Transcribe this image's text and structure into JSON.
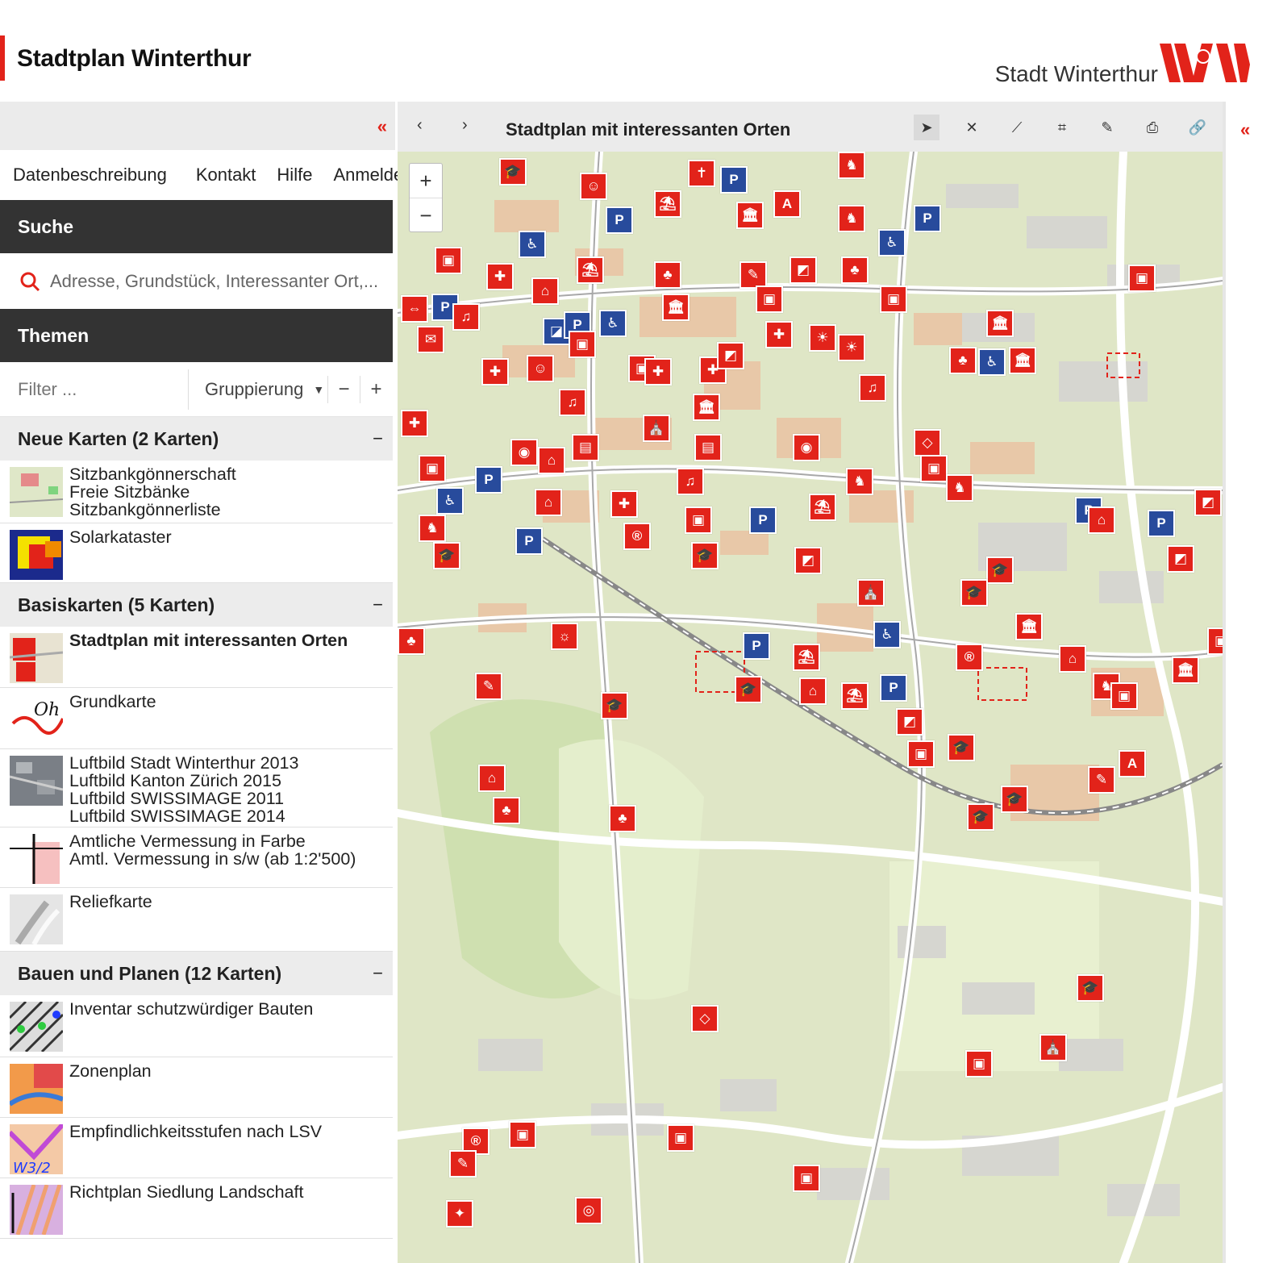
{
  "header": {
    "title": "Stadtplan Winterthur",
    "brand": "Stadt Winterthur",
    "accent_color": "#e2231a"
  },
  "left_panel": {
    "collapse_icon": "double-chevron-left-icon",
    "nav": [
      "Datenbeschreibung",
      "Kontakt",
      "Hilfe",
      "Anmelden"
    ],
    "search": {
      "heading": "Suche",
      "placeholder": "Adresse, Grundstück, Interessanter Ort,..."
    },
    "themes": {
      "heading": "Themen",
      "filter_placeholder": "Filter ...",
      "grouping_label": "Gruppierung",
      "collapse_all": "−",
      "expand_all": "+"
    },
    "groups": [
      {
        "title": "Neue Karten (2 Karten)",
        "toggle": "−",
        "layers": [
          {
            "lines": [
              "Sitzbankgönnerschaft",
              "Freie Sitzbänke",
              "Sitzbankgönnerliste"
            ]
          },
          {
            "lines": [
              "Solarkataster"
            ]
          }
        ]
      },
      {
        "title": "Basiskarten (5 Karten)",
        "toggle": "−",
        "layers": [
          {
            "lines": [
              "Stadtplan mit interessanten Orten"
            ],
            "active": true
          },
          {
            "lines": [
              "Grundkarte"
            ]
          },
          {
            "lines": [
              "Luftbild Stadt Winterthur 2013",
              "Luftbild Kanton Zürich 2015",
              "Luftbild SWISSIMAGE 2011",
              "Luftbild SWISSIMAGE 2014"
            ]
          },
          {
            "lines": [
              "Amtliche Vermessung in Farbe",
              "Amtl. Vermessung in s/w (ab 1:2'500)"
            ]
          },
          {
            "lines": [
              "Reliefkarte"
            ]
          }
        ]
      },
      {
        "title": "Bauen und Planen (12 Karten)",
        "toggle": "−",
        "layers": [
          {
            "lines": [
              "Inventar schutzwürdiger Bauten"
            ]
          },
          {
            "lines": [
              "Zonenplan"
            ]
          },
          {
            "lines": [
              "Empfindlichkeitsstufen nach LSV"
            ]
          },
          {
            "lines": [
              "Richtplan Siedlung Landschaft"
            ]
          }
        ]
      }
    ]
  },
  "map": {
    "title": "Stadtplan mit interessanten Orten",
    "prev_icon": "chevron-left-icon",
    "next_icon": "chevron-right-icon",
    "tools": [
      "pointer-icon",
      "close-icon",
      "measure-line-icon",
      "measure-area-icon",
      "draw-icon",
      "print-icon",
      "link-icon"
    ],
    "zoom_in": "+",
    "zoom_out": "−",
    "poi_colors": {
      "red": "#e2231a",
      "blue": "#284b9c"
    }
  },
  "right_panel": {
    "collapse_icon": "double-chevron-left-icon"
  }
}
